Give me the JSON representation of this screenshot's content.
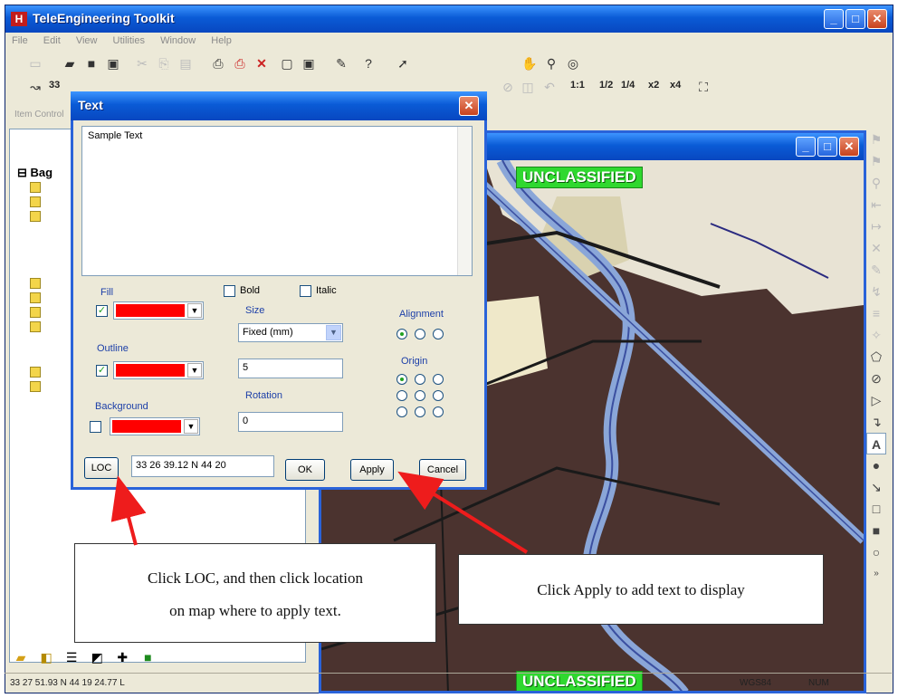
{
  "app": {
    "title": "TeleEngineering Toolkit",
    "logo_letter": "H",
    "window_buttons": [
      "_",
      "□",
      "✕"
    ]
  },
  "menu": [
    "File",
    "Edit",
    "View",
    "Utilities",
    "Window",
    "Help"
  ],
  "toolbar2": {
    "coord_prefix": "33",
    "zoom_labels": [
      "1:1",
      "1/2",
      "1/4",
      "x2",
      "x4"
    ]
  },
  "left_panel": {
    "header": "Item Control",
    "tree_root": "Bag"
  },
  "map": {
    "banner_top": "UNCLASSIFIED",
    "banner_bottom": "UNCLASSIFIED"
  },
  "dialog": {
    "title": "Text",
    "text_value": "Sample Text",
    "fill_label": "Fill",
    "outline_label": "Outline",
    "background_label": "Background",
    "bold_label": "Bold",
    "italic_label": "Italic",
    "size_label": "Size",
    "size_value": "Fixed (mm)",
    "size_number": "5",
    "rotation_label": "Rotation",
    "rotation_value": "0",
    "alignment_label": "Alignment",
    "origin_label": "Origin",
    "loc_button": "LOC",
    "loc_value": "33 26 39.12 N  44 20",
    "ok_button": "OK",
    "apply_button": "Apply",
    "cancel_button": "Cancel",
    "fill_color": "#ff0000",
    "outline_color": "#ff0000",
    "background_color": "#ff0000"
  },
  "callouts": {
    "loc_line1": "Click LOC, and then click location",
    "loc_line2": "on map where to apply text.",
    "apply": "Click Apply to add text to display"
  },
  "status": {
    "coords": "33 27 51.93 N  44 19 24.77 L",
    "datum": "WGS84",
    "num": "NUM"
  }
}
